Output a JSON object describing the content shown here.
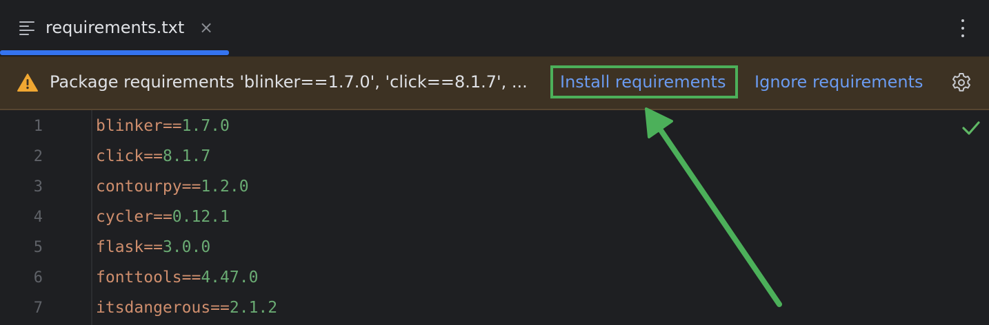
{
  "tab": {
    "title": "requirements.txt",
    "close_glyph": "×",
    "icon": "text-file-icon"
  },
  "banner": {
    "message": "Package requirements 'blinker==1.7.0', 'click==8.1.7', ...",
    "install_label": "Install requirements",
    "ignore_label": "Ignore requirements",
    "warning_icon": "warning-icon",
    "settings_icon": "gear-icon"
  },
  "editor": {
    "lines": [
      {
        "num": "1",
        "pkg": "blinker",
        "op": "==",
        "ver": "1.7.0"
      },
      {
        "num": "2",
        "pkg": "click",
        "op": "==",
        "ver": "8.1.7"
      },
      {
        "num": "3",
        "pkg": "contourpy",
        "op": "==",
        "ver": "1.2.0"
      },
      {
        "num": "4",
        "pkg": "cycler",
        "op": "==",
        "ver": "0.12.1"
      },
      {
        "num": "5",
        "pkg": "flask",
        "op": "==",
        "ver": "3.0.0"
      },
      {
        "num": "6",
        "pkg": "fonttools",
        "op": "==",
        "ver": "4.47.0"
      },
      {
        "num": "7",
        "pkg": "itsdangerous",
        "op": "==",
        "ver": "2.1.2"
      }
    ]
  },
  "colors": {
    "accent": "#3574f0",
    "banner_bg": "#3d3223",
    "link": "#6b9bf0",
    "highlight": "#4cb05a",
    "package_name": "#cf8e6d",
    "version": "#6aab73"
  }
}
